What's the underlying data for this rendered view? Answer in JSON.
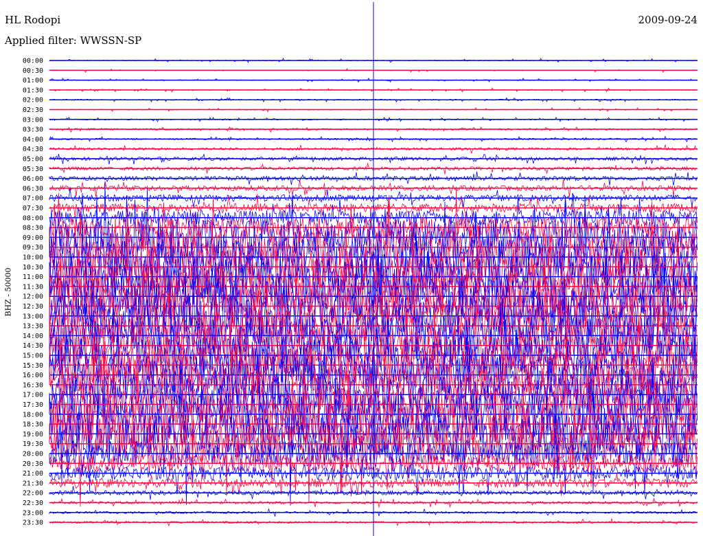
{
  "header": {
    "station": "HL Rodopi",
    "filter": "Applied filter: WWSSN-SP",
    "date": "2009-09-24"
  },
  "chart_data": {
    "type": "line",
    "title": "HL Rodopi",
    "subtitle": "Applied filter: WWSSN-SP",
    "date": "2009-09-24",
    "ylabel": "BHZ - 50000",
    "colors": [
      "#0000ff",
      "#ff0040"
    ],
    "rows": [
      "00:00",
      "00:30",
      "01:00",
      "01:30",
      "02:00",
      "02:30",
      "03:00",
      "03:30",
      "04:00",
      "04:30",
      "05:00",
      "05:30",
      "06:00",
      "06:30",
      "07:00",
      "07:30",
      "08:00",
      "08:30",
      "09:00",
      "09:30",
      "10:00",
      "10:30",
      "11:00",
      "11:30",
      "12:00",
      "12:30",
      "13:00",
      "13:30",
      "14:00",
      "14:30",
      "15:00",
      "15:30",
      "16:00",
      "16:30",
      "17:00",
      "17:30",
      "18:00",
      "18:30",
      "19:00",
      "19:30",
      "20:00",
      "20:30",
      "21:00",
      "21:30",
      "22:00",
      "22:30",
      "23:00",
      "23:30"
    ],
    "relative_amplitude": [
      0.02,
      0.01,
      0.02,
      0.02,
      0.03,
      0.02,
      0.03,
      0.04,
      0.04,
      0.06,
      0.08,
      0.08,
      0.1,
      0.12,
      0.15,
      0.2,
      0.35,
      0.5,
      0.8,
      0.85,
      0.9,
      0.95,
      1,
      1,
      1,
      0.95,
      0.95,
      0.9,
      0.9,
      0.9,
      0.9,
      0.9,
      0.9,
      0.85,
      0.85,
      0.8,
      1,
      1,
      1,
      0.9,
      0.6,
      0.4,
      0.3,
      0.2,
      0.1,
      0.06,
      0.05,
      0.05
    ]
  }
}
